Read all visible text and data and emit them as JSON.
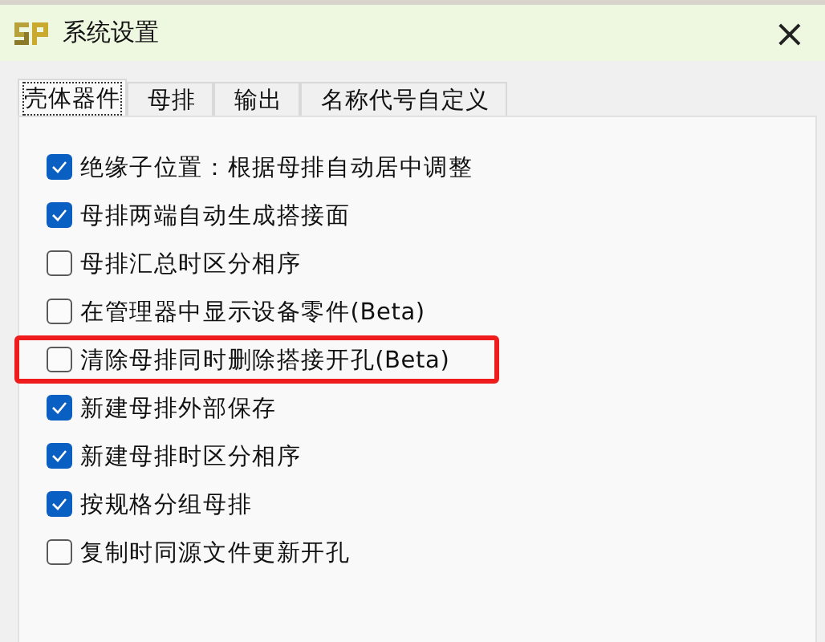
{
  "window": {
    "title": "系统设置",
    "close": "×"
  },
  "tabs": [
    {
      "label": "壳体器件",
      "selected": true
    },
    {
      "label": "母排",
      "selected": false
    },
    {
      "label": "输出",
      "selected": false
    },
    {
      "label": "名称代号自定义",
      "selected": false
    }
  ],
  "options": [
    {
      "label": "绝缘子位置：根据母排自动居中调整",
      "checked": true,
      "highlighted": false
    },
    {
      "label": "母排两端自动生成搭接面",
      "checked": true,
      "highlighted": false
    },
    {
      "label": "母排汇总时区分相序",
      "checked": false,
      "highlighted": false
    },
    {
      "label": "在管理器中显示设备零件(Beta)",
      "checked": false,
      "highlighted": false
    },
    {
      "label": "清除母排同时删除搭接开孔(Beta)",
      "checked": false,
      "highlighted": true
    },
    {
      "label": "新建母排外部保存",
      "checked": true,
      "highlighted": false
    },
    {
      "label": "新建母排时区分相序",
      "checked": true,
      "highlighted": false
    },
    {
      "label": "按规格分组母排",
      "checked": true,
      "highlighted": false
    },
    {
      "label": "复制时同源文件更新开孔",
      "checked": false,
      "highlighted": false
    }
  ]
}
